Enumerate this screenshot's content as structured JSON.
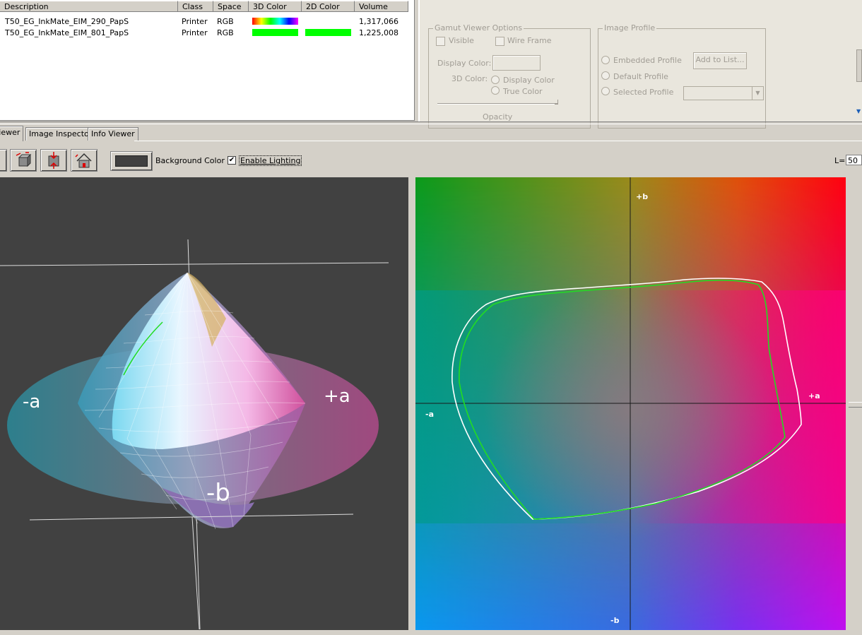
{
  "table": {
    "headers": [
      "Description",
      "Class",
      "Space",
      "3D Color",
      "2D Color",
      "Volume"
    ],
    "rows": [
      {
        "description": "T50_EG_InkMate_EIM_290_PapS",
        "class": "Printer",
        "space": "RGB",
        "color3d": "rainbow",
        "color2d": "none",
        "volume": "1,317,066"
      },
      {
        "description": "T50_EG_InkMate_EIM_801_PapS",
        "class": "Printer",
        "space": "RGB",
        "color3d": "#00ff00",
        "color2d": "#00ff00",
        "volume": "1,225,008"
      }
    ]
  },
  "gamut_options": {
    "title": "Gamut Viewer Options",
    "visible_label": "Visible",
    "wireframe_label": "Wire Frame",
    "display_color_label": "Display Color:",
    "color3d_label": "3D Color:",
    "display_color_radio": "Display Color",
    "true_color_radio": "True Color",
    "opacity_label": "Opacity"
  },
  "image_profile": {
    "title": "Image Profile",
    "embedded": "Embedded Profile",
    "default": "Default Profile",
    "selected": "Selected Profile",
    "add_button": "Add to List..."
  },
  "tabs": [
    "Viewer",
    "Image Inspector",
    "Info Viewer"
  ],
  "toolbar": {
    "background_color_label": "Background Color",
    "enable_lighting_label": "Enable Lighting",
    "enable_lighting_checked": true,
    "l_label": "L=",
    "l_value": "50"
  },
  "viewer3d": {
    "axis_neg_a": "-a",
    "axis_pos_a": "+a",
    "axis_neg_b": "-b"
  },
  "viewer2d": {
    "pos_b": "+b",
    "neg_b": "-b",
    "pos_a": "+a",
    "neg_a": "-a",
    "outline_colors": [
      "#ffffff",
      "#22dd22"
    ]
  },
  "colors": {
    "panel_bg": "#d4d0c8",
    "viewer_bg": "#414141",
    "swatch_bg": "#404040"
  }
}
